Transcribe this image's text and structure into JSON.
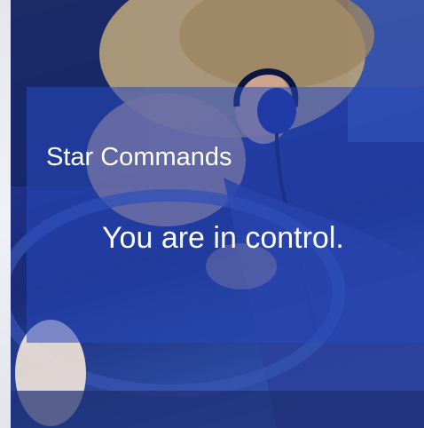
{
  "slide": {
    "title": "Star Commands",
    "tagline": "You are in control."
  },
  "colors": {
    "overlay": "#2648BE",
    "text": "#FFFFFF",
    "photo_tint": "#20328A"
  },
  "icons": {
    "earpiece": "earpiece-icon"
  }
}
